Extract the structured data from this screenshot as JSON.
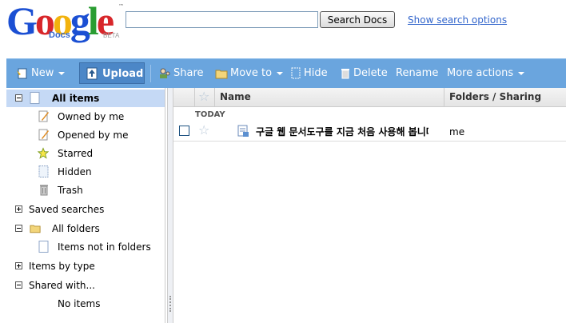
{
  "header": {
    "logo": {
      "word": "Google",
      "product": "Docs",
      "tag": "BETA",
      "trademark": "™"
    },
    "search": {
      "value": "",
      "placeholder": ""
    },
    "search_button": "Search Docs",
    "show_options_link": "Show search options"
  },
  "toolbar": {
    "new": "New",
    "upload": "Upload",
    "share": "Share",
    "move_to": "Move to",
    "hide": "Hide",
    "delete": "Delete",
    "rename": "Rename",
    "more_actions": "More actions"
  },
  "sidebar": {
    "all_items": "All items",
    "owned_by_me": "Owned by me",
    "opened_by_me": "Opened by me",
    "starred": "Starred",
    "hidden": "Hidden",
    "trash": "Trash",
    "saved_searches": "Saved searches",
    "all_folders": "All folders",
    "items_not_in_folders": "Items not in folders",
    "items_by_type": "Items by type",
    "shared_with": "Shared with...",
    "no_items": "No items"
  },
  "list": {
    "columns": {
      "name": "Name",
      "folders_sharing": "Folders / Sharing"
    },
    "group_today": "TODAY",
    "rows": [
      {
        "title": "구글 웹 문서도구를 지금 처음 사용해 봅니다",
        "owner": "me"
      }
    ]
  },
  "colors": {
    "toolbar": "#6aa5de",
    "selected": "#c5d9f5",
    "link": "#3366cc"
  }
}
